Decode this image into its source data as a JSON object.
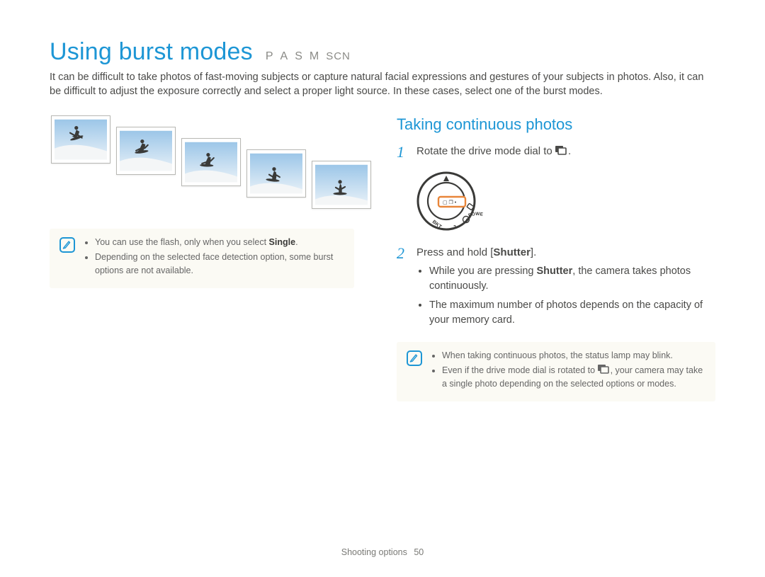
{
  "title": "Using burst modes",
  "modes": [
    "P",
    "A",
    "S",
    "M",
    "SCN"
  ],
  "intro": "It can be difficult to take photos of fast-moving subjects or capture natural facial expressions and gestures of your subjects in photos. Also, it can be difficult to adjust the exposure correctly and select a proper light source. In these cases, select one of the burst modes.",
  "left_notes": {
    "items": [
      {
        "pre": "You can use the flash, only when you select ",
        "bold": "Single",
        "post": "."
      },
      {
        "pre": "Depending on the selected face detection option, some burst options are not available.",
        "bold": "",
        "post": ""
      }
    ]
  },
  "section_title": "Taking continuous photos",
  "steps": {
    "s1": {
      "num": "1",
      "text_pre": "Rotate the drive mode dial to ",
      "text_post": "."
    },
    "s2": {
      "num": "2",
      "text_pre": "Press and hold [",
      "bold": "Shutter",
      "text_post": "].",
      "bullets": [
        {
          "pre": "While you are pressing ",
          "bold": "Shutter",
          "post": ", the camera takes photos continuously."
        },
        {
          "pre": "The maximum number of photos depends on the capacity of your memory card.",
          "bold": "",
          "post": ""
        }
      ]
    }
  },
  "right_notes": {
    "items": [
      {
        "pre": "When taking continuous photos, the status lamp may blink.",
        "bold": "",
        "post": ""
      },
      {
        "pre": "Even if the drive mode dial is rotated to ",
        "icon": true,
        "post": ", your camera may take a single photo depending on the selected options or modes."
      }
    ]
  },
  "footer": {
    "section": "Shooting options",
    "page": "50"
  }
}
